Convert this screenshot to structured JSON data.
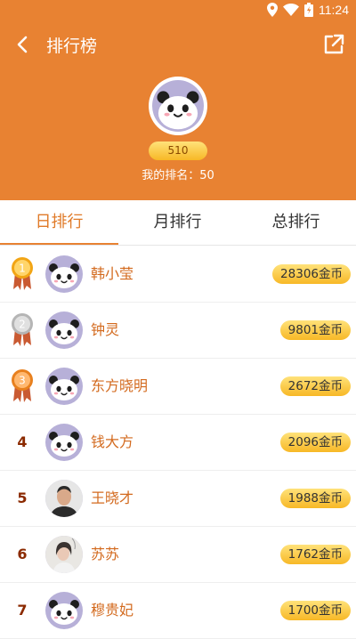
{
  "status_bar": {
    "time": "11:24",
    "icons": [
      "location-icon",
      "wifi-icon",
      "battery-icon"
    ]
  },
  "header": {
    "title": "排行榜",
    "back_icon": "back-arrow-icon",
    "share_icon": "share-icon",
    "my_score": "510",
    "my_rank_text": "我的排名：50"
  },
  "tabs": [
    {
      "label": "日排行",
      "active": true
    },
    {
      "label": "月排行",
      "active": false
    },
    {
      "label": "总排行",
      "active": false
    }
  ],
  "rankings": [
    {
      "rank": "1",
      "medal": "gold",
      "name": "韩小莹",
      "coins": "28306金币",
      "avatar": "panda"
    },
    {
      "rank": "2",
      "medal": "silver",
      "name": "钟灵",
      "coins": "9801金币",
      "avatar": "panda"
    },
    {
      "rank": "3",
      "medal": "bronze",
      "name": "东方晓明",
      "coins": "2672金币",
      "avatar": "panda"
    },
    {
      "rank": "4",
      "medal": null,
      "name": "钱大方",
      "coins": "2096金币",
      "avatar": "panda"
    },
    {
      "rank": "5",
      "medal": null,
      "name": "王晓才",
      "coins": "1988金币",
      "avatar": "photo-man"
    },
    {
      "rank": "6",
      "medal": null,
      "name": "苏苏",
      "coins": "1762金币",
      "avatar": "photo-woman"
    },
    {
      "rank": "7",
      "medal": null,
      "name": "穆贵妃",
      "coins": "1700金币",
      "avatar": "panda"
    }
  ],
  "colors": {
    "accent": "#E88232",
    "active_tab": "#E07A28",
    "name_text": "#D36A1E",
    "rank_text": "#8B2A00",
    "coin_pill": "#F7B826"
  }
}
